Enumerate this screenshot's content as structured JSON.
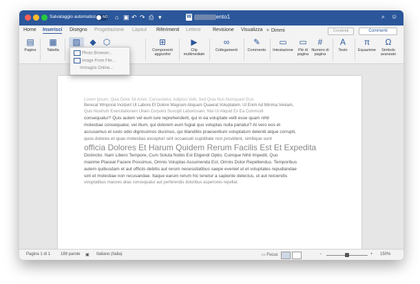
{
  "titlebar": {
    "autosave_label": "Salvataggio automatico",
    "autosave_state": "NO",
    "quick_access": [
      "⌂",
      "▣",
      "↶",
      "↷",
      "⎙",
      "▾"
    ],
    "doc_icon": "W",
    "doc_name": "ento1",
    "search_icon": "⌕",
    "profile_icon": "☺"
  },
  "tabs": [
    "Home",
    "Inserisci",
    "Disegno",
    "Progettazione",
    "Layout",
    "Riferimenti",
    "Lettere",
    "Revisione",
    "Visualizza"
  ],
  "tell_me": "Dimmi",
  "share_label": "Condividi",
  "comments_label": "Commenti",
  "ribbon": [
    {
      "label": "Pagine",
      "icon": "▤"
    },
    {
      "label": "Tabella",
      "icon": "▦"
    },
    {
      "label": "",
      "icon": "▨"
    },
    {
      "label": "",
      "icon": "◆"
    },
    {
      "label": "",
      "icon": "⬡"
    },
    {
      "label": "Componenti aggiuntivi",
      "icon": "⊞"
    },
    {
      "label": "Clip multimediale",
      "icon": "▶"
    },
    {
      "label": "Collegamenti",
      "icon": "∞"
    },
    {
      "label": "Commento",
      "icon": "✎"
    },
    {
      "label": "Intestazione",
      "icon": "▭"
    },
    {
      "label": "Piè di pagina",
      "icon": "▭"
    },
    {
      "label": "Numero di pagina",
      "icon": "#"
    },
    {
      "label": "Testo",
      "icon": "A"
    },
    {
      "label": "Equazione",
      "icon": "π"
    },
    {
      "label": "Simbolo avanzato",
      "icon": "Ω"
    }
  ],
  "dropdown": {
    "items": [
      "Photo Browser...",
      "Image From File...",
      "Immagini Online..."
    ]
  },
  "document": {
    "lines": [
      "Lorem Ipsum, Quia Dolor Sit Amet, Consectetur, Adipisci Velit, Sed Quia Non Numquam Eius",
      "Berecat Wmporal Incidunt Ut Labore Et Dolore Magnam Aliquam Quaerat Voluptatem. Ut Enim Ad Minima Veniam,",
      "Quis Nostrum Exercitationem Ullam Corporis Suscipit Laboriosam, Nisi Ut Aliquid Ex Ea Commodi",
      "consequatur? Quis autem vel eum iure reprehenderit, qui in ea voluptate velit esse quam nihil",
      "molestiae consequatur, vel illum, qui dolorem eum fugiat quo voluptas nulla pariatur? At vero eos et",
      "accusamus et iusto odio dignissimos ducimus, qui blanditiis praesentium voluptatum deleniti atque corrupti,",
      "quos dolores et quas molestias excepturi sint occaecati cupiditate non provident, similique sunt",
      "officia Dolores Et Harum Quidem Rerum Facilis Est Et Expedita",
      "Distinctio. Nam Libero Tempore, Cum Soluta Nobis Est Eligendi Optio, Cumque Nihil Impedit, Quo",
      "maxime Placeat Facere Possimus, Omnis Voluptas Assumenda Est, Omnis Dolor Repellendus. Temporibus",
      "autem quibusdam et aut officiis debitis aut rerum necessitatibus saepe eveniet ut et voluptates repudiandae",
      "sint et molestiae non recusandae. Itaque earum rerum hic tenetur a sapiente delectus, ut aut reiciendis",
      "voluptatibus maiores alias consequatur aut perferendis doloribus asperiores repellat."
    ]
  },
  "statusbar": {
    "page": "Pagina 1 di 1",
    "words": "189 parole",
    "language": "Italiano (Italia)",
    "focus": "Focus",
    "zoom": "150%"
  },
  "colors": {
    "accent": "#2b579a",
    "close": "#ff5f57",
    "minimize": "#febc2e",
    "maximize": "#28c840"
  }
}
